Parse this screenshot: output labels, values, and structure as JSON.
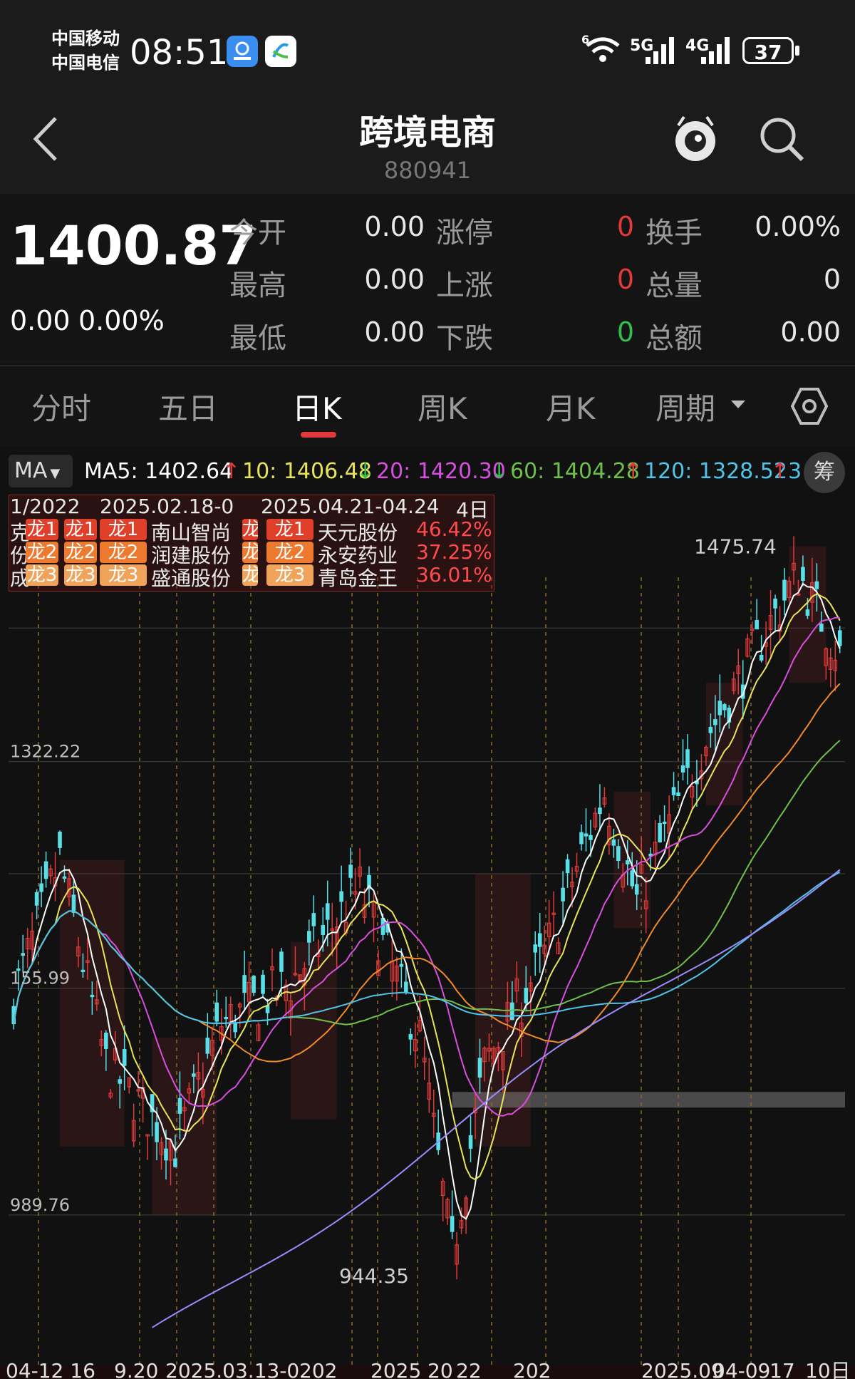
{
  "status_bar": {
    "carrier1": "中国移动",
    "carrier2": "中国电信",
    "time": "08:51",
    "net1": "6",
    "net2": "5G",
    "net3": "4G",
    "battery": "37"
  },
  "header": {
    "back_icon": "chevron-left-icon",
    "title": "跨境电商",
    "code": "880941",
    "assistant_icon": "robot-eye-icon",
    "search_icon": "search-icon"
  },
  "quote": {
    "price": "1400.87",
    "change": "0.00",
    "change_pct": "0.00%",
    "rows": [
      {
        "l1": "今开",
        "v1": "0.00",
        "l2": "涨停",
        "v2": "0",
        "l3": "换手",
        "v3": "0.00%"
      },
      {
        "l1": "最高",
        "v1": "0.00",
        "l2": "上涨",
        "v2": "0",
        "l3": "总量",
        "v3": "0"
      },
      {
        "l1": "最低",
        "v1": "0.00",
        "l2": "下跌",
        "v2": "0",
        "l3": "总额",
        "v3": "0.00"
      }
    ],
    "colors": {
      "up": "#e23a3a",
      "down": "#2fbf4e"
    }
  },
  "tabs": {
    "items": [
      "分时",
      "五日",
      "日K",
      "周K",
      "月K",
      "周期"
    ],
    "active": "日K",
    "settings_icon": "hexagon-settings-icon"
  },
  "ma": {
    "selector": "MA",
    "ma5": "MA5: 1402.64",
    "ma10": "10: 1406.48",
    "ma20": "20: 1420.30",
    "ma60": "60: 1404.28",
    "ma120": "120: 1328.52",
    "ma_more": "3",
    "chou": "筹",
    "colors": {
      "ma5": "#ffffff",
      "ma10": "#e8e45a",
      "ma20": "#d84fe0",
      "ma60": "#6fbf4a",
      "ma120": "#4fc3e8",
      "ma250": "#9a8cff",
      "up": "#e23a3a",
      "down": "#2fbf4e"
    }
  },
  "dragon": {
    "header_left": "1/2022",
    "header_mid": "2025.02.18-0",
    "header_right": "2025.04.21-04.24",
    "days": "4日",
    "left_prefixes": [
      "克",
      "份",
      "成"
    ],
    "tags": [
      "龙1",
      "龙2",
      "龙3"
    ],
    "left_stocks": [
      "南山智尚",
      "润建股份",
      "盛通股份"
    ],
    "right_stocks": [
      "天元股份",
      "永安药业",
      "青岛金王"
    ],
    "right_pcts": [
      "46.42%",
      "37.25%",
      "36.01%"
    ]
  },
  "chart_data": {
    "type": "candlestick",
    "high_label": "1475.74",
    "low_label": "944.35",
    "y_labels": [
      "1322.22",
      "155.99",
      "989.76"
    ],
    "x_labels": [
      "04-12 16",
      "9.20",
      "2025.03.13-0",
      "202",
      "2025",
      "20",
      "22",
      "202",
      "2025.09",
      "04-09",
      "17",
      "10日"
    ],
    "ylim": [
      880,
      1520
    ],
    "series_note": "daily K with MA lines"
  }
}
